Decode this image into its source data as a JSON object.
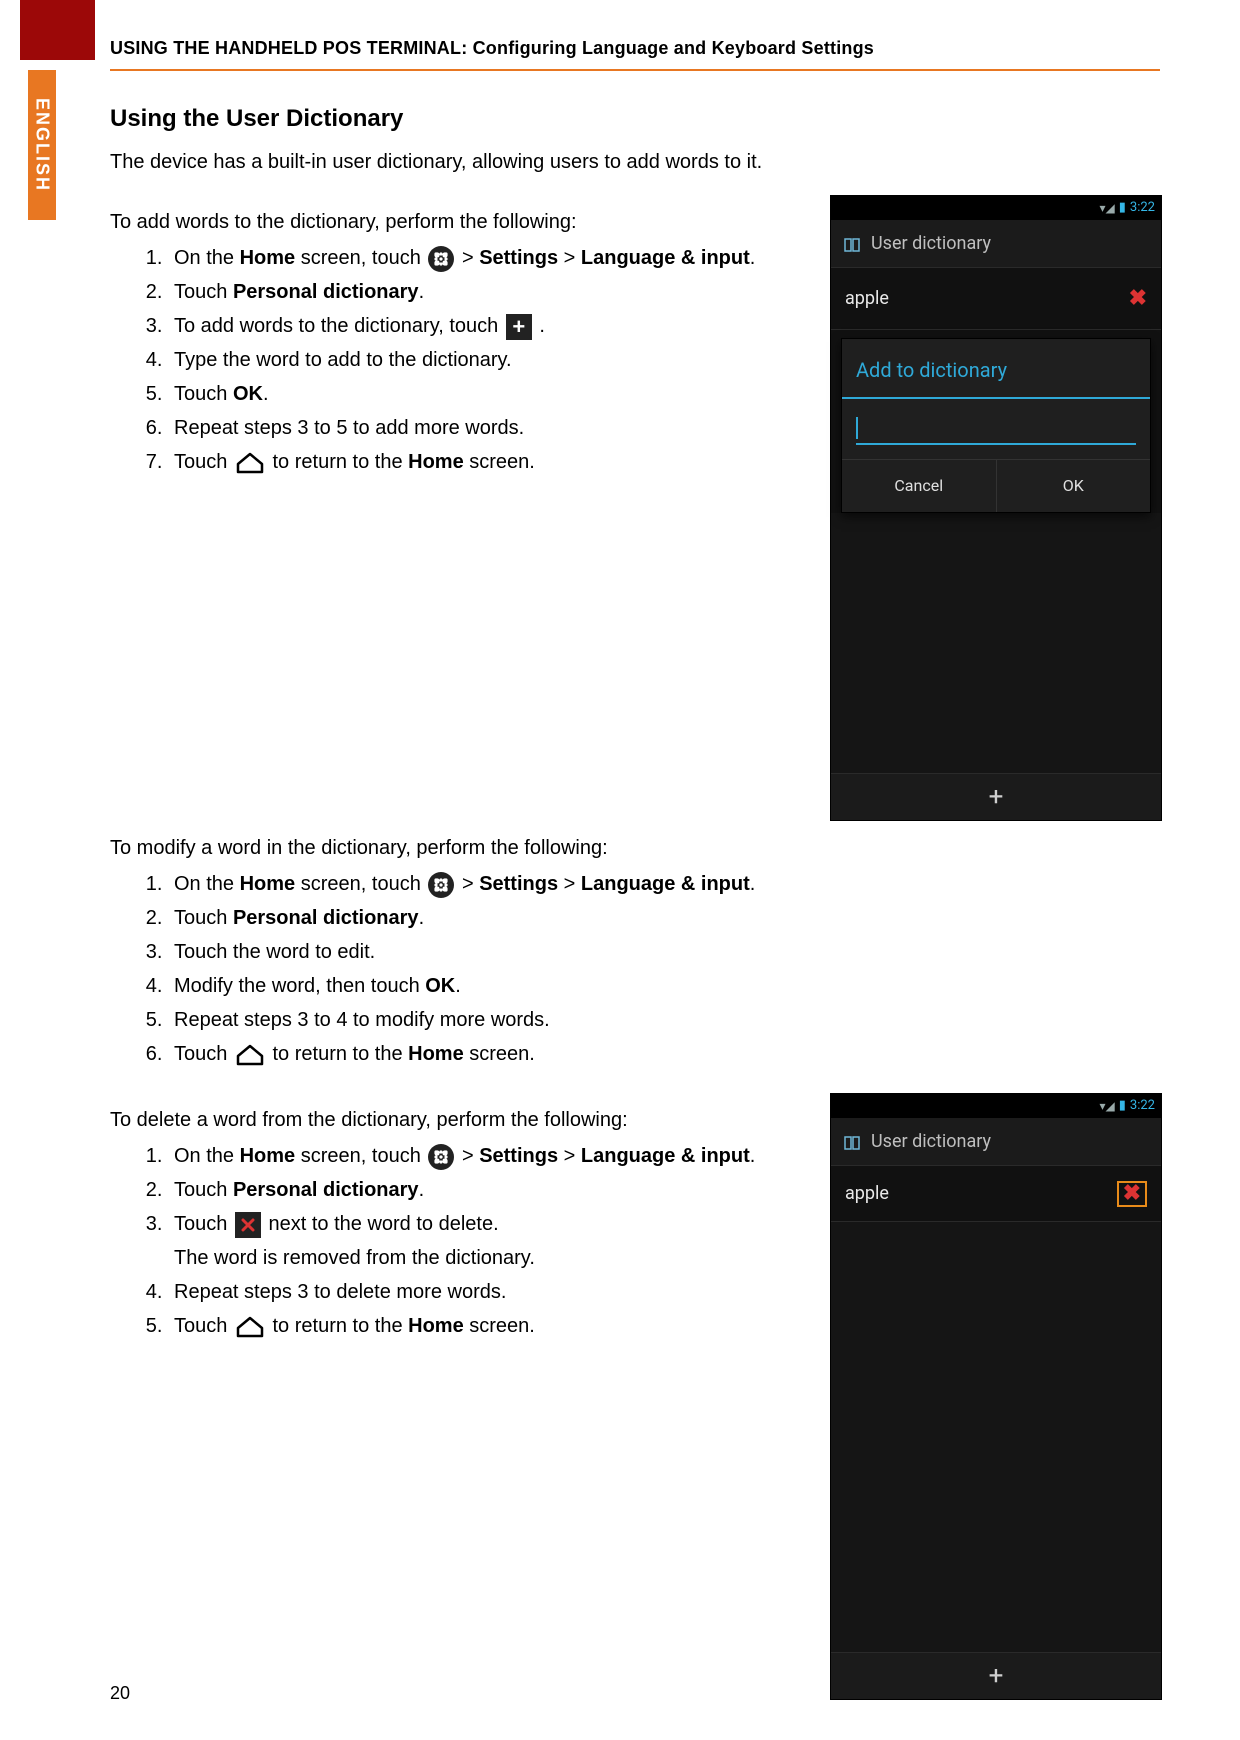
{
  "header": {
    "running_head": "USING THE HANDHELD POS TERMINAL: Configuring Language and Keyboard Settings",
    "lang_tab": "ENGLISH"
  },
  "section": {
    "title": "Using the User Dictionary",
    "intro": "The device has a built-in user dictionary, allowing users to add words to it."
  },
  "add": {
    "lead": "To add words to the dictionary, perform the following:",
    "steps": {
      "s1a": "On the ",
      "s1_home": "Home",
      "s1b": " screen, touch ",
      "s1c": "  > ",
      "s1_settings": "Settings",
      "s1d": " > ",
      "s1_lang": "Language & input",
      "s1e": ".",
      "s2a": "Touch ",
      "s2b": "Personal dictionary",
      "s2c": ".",
      "s3a": "To add words to the dictionary, touch ",
      "s3b": ".",
      "s4": "Type the word to add to the dictionary.",
      "s5a": "Touch ",
      "s5b": "OK",
      "s5c": ".",
      "s6": "Repeat steps 3 to 5 to add more words.",
      "s7a": "Touch ",
      "s7b": " to return to the ",
      "s7c": "Home",
      "s7d": " screen."
    }
  },
  "modify": {
    "lead": "To modify a word in the dictionary, perform the following:",
    "steps": {
      "s1a": "On the ",
      "s1_home": "Home",
      "s1b": " screen, touch ",
      "s1c": "  > ",
      "s1_settings": "Settings",
      "s1d": " > ",
      "s1_lang": "Language & input",
      "s1e": ".",
      "s2a": "Touch ",
      "s2b": "Personal dictionary",
      "s2c": ".",
      "s3": "Touch the word to edit.",
      "s4a": "Modify the word, then touch ",
      "s4b": "OK",
      "s4c": ".",
      "s5": "Repeat steps 3 to 4 to modify more words.",
      "s6a": "Touch ",
      "s6b": " to return to the ",
      "s6c": "Home",
      "s6d": " screen."
    }
  },
  "delete": {
    "lead": "To delete a word from the dictionary, perform the following:",
    "steps": {
      "s1a": "On the ",
      "s1_home": "Home",
      "s1b": " screen, touch ",
      "s1c": "  > ",
      "s1_settings": "Settings",
      "s1d": " > ",
      "s1_lang": "Language & input",
      "s1e": ".",
      "s2a": "Touch ",
      "s2b": "Personal dictionary",
      "s2c": ".",
      "s3a": "Touch ",
      "s3b": " next to the word to delete.",
      "s3sub": "The word is removed from the dictionary.",
      "s4": "Repeat steps 3 to delete more words.",
      "s5a": "Touch ",
      "s5b": " to return to the ",
      "s5c": "Home",
      "s5d": " screen."
    }
  },
  "device1": {
    "time": "3:22",
    "title": "User dictionary",
    "word": "apple",
    "dialog_title": "Add to dictionary",
    "cancel": "Cancel",
    "ok": "OK",
    "plus": "+"
  },
  "device2": {
    "time": "3:22",
    "title": "User dictionary",
    "word": "apple",
    "plus": "+"
  },
  "footer": {
    "page": "20"
  }
}
